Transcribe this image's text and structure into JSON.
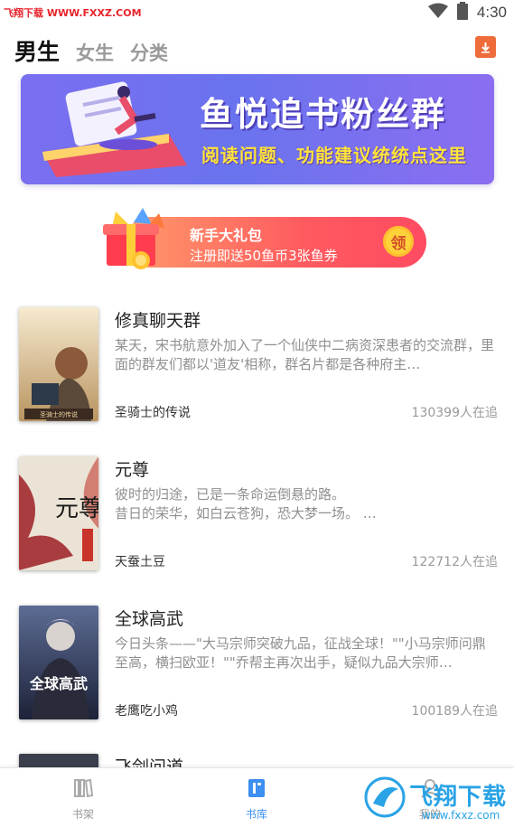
{
  "status_bar": {
    "watermark": "飞翔下载 WWW.FXXZ.COM",
    "time": "4:30"
  },
  "tabs": [
    {
      "label": "男生",
      "active": true
    },
    {
      "label": "女生",
      "active": false
    },
    {
      "label": "分类",
      "active": false
    }
  ],
  "banner": {
    "title": "鱼悦追书粉丝群",
    "subtitle": "阅读问题、功能建议统统点这里"
  },
  "promo": {
    "title": "新手大礼包",
    "subtitle": "注册即送50鱼币3张鱼券",
    "claim_label": "领"
  },
  "books": [
    {
      "title": "修真聊天群",
      "description": "某天，宋书航意外加入了一个仙侠中二病资深患者的交流群，里面的群友们都以'道友'相称，群名片都是各种府主…",
      "author": "圣骑士的传说",
      "readers": "130399人在追",
      "cover_text": "圣骑士的传说",
      "cover_colors": [
        "#f3e6c8",
        "#c9a86a"
      ]
    },
    {
      "title": "元尊",
      "description": "彼时的归途，已是一条命运倒悬的路。\n昔日的荣华，如白云苍狗，恐大梦一场。 …",
      "author": "天蚕土豆",
      "readers": "122712人在追",
      "cover_text": "元尊",
      "cover_colors": [
        "#e9e3d6",
        "#b8322e"
      ]
    },
    {
      "title": "全球高武",
      "description": "今日头条——\"大马宗师突破九品，征战全球！\"\"小马宗师问鼎至高，横扫欧亚！\"\"乔帮主再次出手，疑似九品大宗师…",
      "author": "老鹰吃小鸡",
      "readers": "100189人在追",
      "cover_text": "全球高武",
      "cover_colors": [
        "#2b3550",
        "#6c7fb2"
      ]
    },
    {
      "title": "飞剑问道",
      "description": "",
      "author": "",
      "readers": "",
      "cover_text": "",
      "cover_colors": [
        "#3b3f4d",
        "#6a6f80"
      ]
    }
  ],
  "bottom_nav": [
    {
      "label": "书架",
      "icon": "bookshelf-icon",
      "active": false
    },
    {
      "label": "书库",
      "icon": "library-icon",
      "active": true
    },
    {
      "label": "我的",
      "icon": "profile-icon",
      "active": false
    }
  ],
  "bottom_watermark": {
    "text": "飞翔下载",
    "url": "www.fxxz.com"
  },
  "colors": {
    "accent": "#3d8ff0",
    "promo": "#ff5a5f",
    "banner": "#7a6ff0"
  }
}
